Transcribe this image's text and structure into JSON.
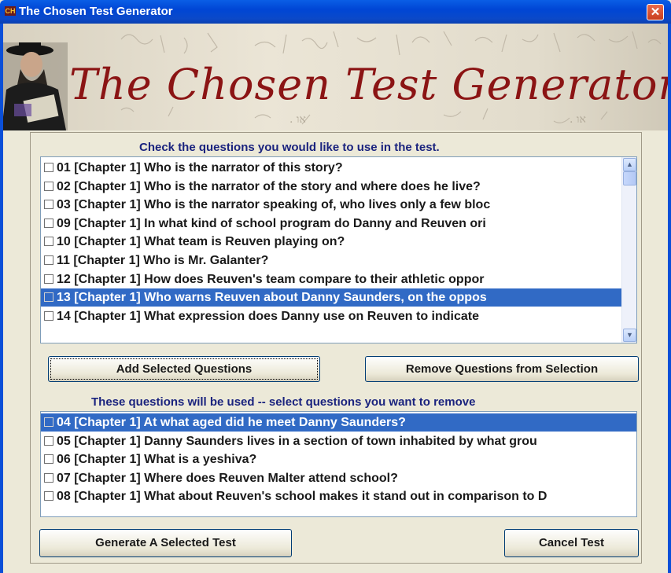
{
  "window": {
    "title": "The Chosen Test Generator",
    "close_glyph": "✕",
    "icon_text": "CH"
  },
  "banner": {
    "title": "The Chosen Test Generator"
  },
  "available": {
    "caption": "Check the questions you would like to use in the test.",
    "items": [
      {
        "label": "01 [Chapter 1] Who is the narrator of this story?",
        "checked": false,
        "selected": false
      },
      {
        "label": "02 [Chapter 1] Who is the narrator of the story and where does he live?",
        "checked": false,
        "selected": false
      },
      {
        "label": "03 [Chapter 1] Who is the narrator speaking of, who lives only a few bloc",
        "checked": false,
        "selected": false
      },
      {
        "label": "09 [Chapter 1] In what kind of school program do Danny and Reuven ori",
        "checked": false,
        "selected": false
      },
      {
        "label": "10 [Chapter 1] What team is Reuven playing on?",
        "checked": false,
        "selected": false
      },
      {
        "label": "11 [Chapter 1] Who is Mr. Galanter?",
        "checked": false,
        "selected": false
      },
      {
        "label": "12 [Chapter 1] How does Reuven's team compare to their athletic oppor",
        "checked": false,
        "selected": false
      },
      {
        "label": "13 [Chapter 1] Who warns Reuven about Danny Saunders, on the oppos",
        "checked": false,
        "selected": true
      },
      {
        "label": "14 [Chapter 1] What expression does Danny use on Reuven to indicate",
        "checked": false,
        "selected": false
      }
    ]
  },
  "buttons": {
    "add": "Add Selected Questions",
    "remove": "Remove Questions from Selection",
    "generate": "Generate A Selected Test",
    "cancel": "Cancel Test"
  },
  "selected_list": {
    "caption": "These questions will be used --  select questions you want to remove",
    "items": [
      {
        "label": "04 [Chapter 1] At what aged did he meet Danny Saunders?",
        "checked": false,
        "selected": true
      },
      {
        "label": "05 [Chapter 1] Danny Saunders lives in a section of town inhabited by what grou",
        "checked": false,
        "selected": false
      },
      {
        "label": "06 [Chapter 1] What is a yeshiva?",
        "checked": false,
        "selected": false
      },
      {
        "label": "07 [Chapter 1] Where does Reuven Malter attend school?",
        "checked": false,
        "selected": false
      },
      {
        "label": "08 [Chapter 1] What about Reuven's school makes it stand out in comparison to D",
        "checked": false,
        "selected": false
      }
    ]
  },
  "colors": {
    "titlebar": "#0046d5",
    "selection": "#316ac5",
    "caption_text": "#1a237e",
    "banner_title": "#8b1414",
    "window_bg": "#ece9d8"
  },
  "icons": {
    "scroll_up": "chevron-up-icon",
    "scroll_down": "chevron-down-icon",
    "close": "close-icon"
  }
}
